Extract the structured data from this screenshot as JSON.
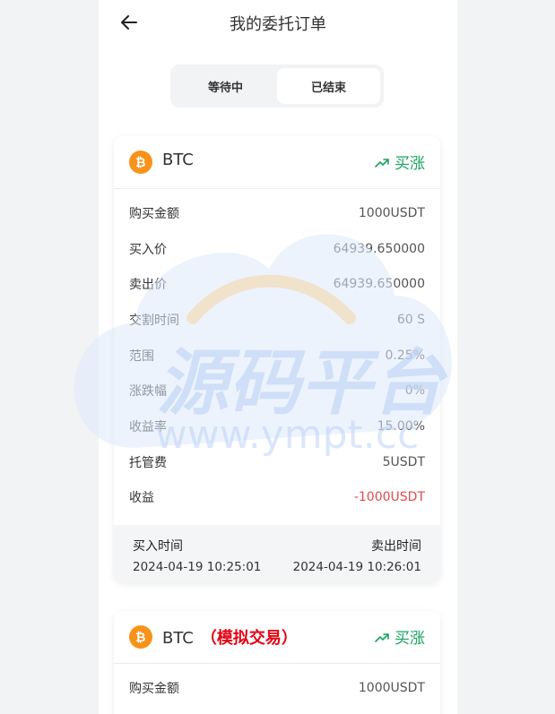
{
  "header": {
    "title": "我的委托订单"
  },
  "tabs": [
    {
      "label": "等待中"
    },
    {
      "label": "已结束"
    }
  ],
  "orders": [
    {
      "coin": "BTC",
      "tag": "",
      "direction": "买涨",
      "rows": [
        {
          "label": "购买金额",
          "value": "1000USDT"
        },
        {
          "label": "买入价",
          "value": "64939.650000"
        },
        {
          "label": "卖出价",
          "value": "64939.650000"
        },
        {
          "label": "交割时间",
          "value": "60 S"
        },
        {
          "label": "范围",
          "value": "0.25%"
        },
        {
          "label": "涨跌幅",
          "value": "0%"
        },
        {
          "label": "收益率",
          "value": "15.00%"
        },
        {
          "label": "托管费",
          "value": "5USDT"
        },
        {
          "label": "收益",
          "value": "-1000USDT"
        }
      ],
      "buy_time_label": "买入时间",
      "sell_time_label": "卖出时间",
      "buy_time": "2024-04-19 10:25:01",
      "sell_time": "2024-04-19 10:26:01"
    },
    {
      "coin": "BTC",
      "tag": "（模拟交易）",
      "direction": "买涨",
      "rows": [
        {
          "label": "购买金额",
          "value": "1000USDT"
        }
      ]
    }
  ],
  "watermark": {
    "main": "源码平台",
    "sub": "www.ympt.cc"
  },
  "colors": {
    "up": "#1aa260",
    "negative": "#e5484d",
    "coin": "#f7931a",
    "tag": "#e60012"
  }
}
